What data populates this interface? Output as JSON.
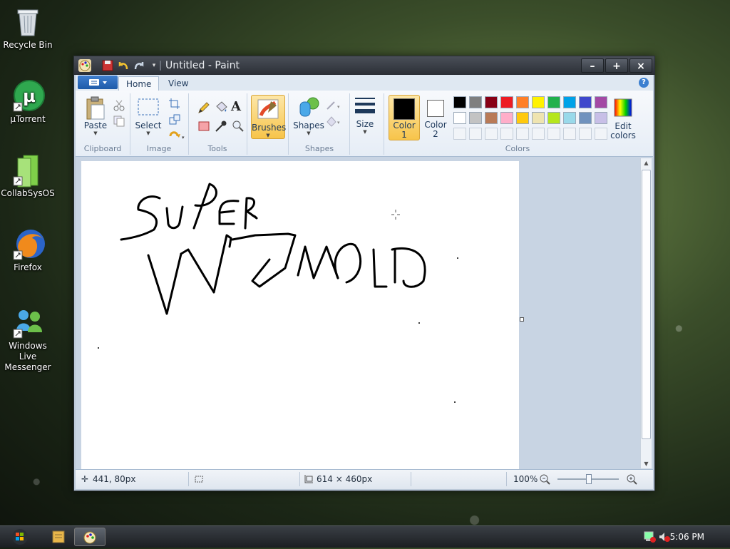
{
  "desktop": {
    "icons": [
      {
        "label": "Recycle Bin"
      },
      {
        "label": "µTorrent"
      },
      {
        "label": "CollabSysOS"
      },
      {
        "label": "Firefox"
      },
      {
        "label": "Windows Live\nMessenger"
      }
    ]
  },
  "window": {
    "title": "Untitled - Paint",
    "buttons": {
      "minimize": "–",
      "maximize": "+",
      "close": "×"
    }
  },
  "tabs": [
    {
      "label": "Home",
      "active": true
    },
    {
      "label": "View",
      "active": false
    }
  ],
  "ribbon": {
    "clipboard": {
      "group_label": "Clipboard",
      "paste_label": "Paste"
    },
    "image": {
      "group_label": "Image",
      "select_label": "Select"
    },
    "tools": {
      "group_label": "Tools",
      "text_glyph": "A"
    },
    "brushes": {
      "label": "Brushes"
    },
    "shapes": {
      "group_label": "Shapes",
      "shapes_label": "Shapes"
    },
    "size": {
      "label": "Size"
    },
    "colors": {
      "group_label": "Colors",
      "color1_label": "Color 1",
      "color2_label": "Color 2",
      "edit_label": "Edit colors",
      "color1": "#000000",
      "color2": "#ffffff",
      "palette_row1": [
        "#000000",
        "#7f7f7f",
        "#880015",
        "#ed1c24",
        "#ff7f27",
        "#fff200",
        "#22b14c",
        "#00a2e8",
        "#3f48cc",
        "#a349a4"
      ],
      "palette_row2": [
        "#ffffff",
        "#c3c3c3",
        "#b97a57",
        "#ffaec9",
        "#ffc90e",
        "#efe4b0",
        "#b5e61d",
        "#99d9ea",
        "#7092be",
        "#c8bfe7"
      ]
    }
  },
  "status": {
    "cursor_pos": "441, 80px",
    "image_size": "614 × 460px",
    "zoom": "100%",
    "zoom_level": 100
  },
  "taskbar": {
    "clock": "5:06 PM"
  }
}
